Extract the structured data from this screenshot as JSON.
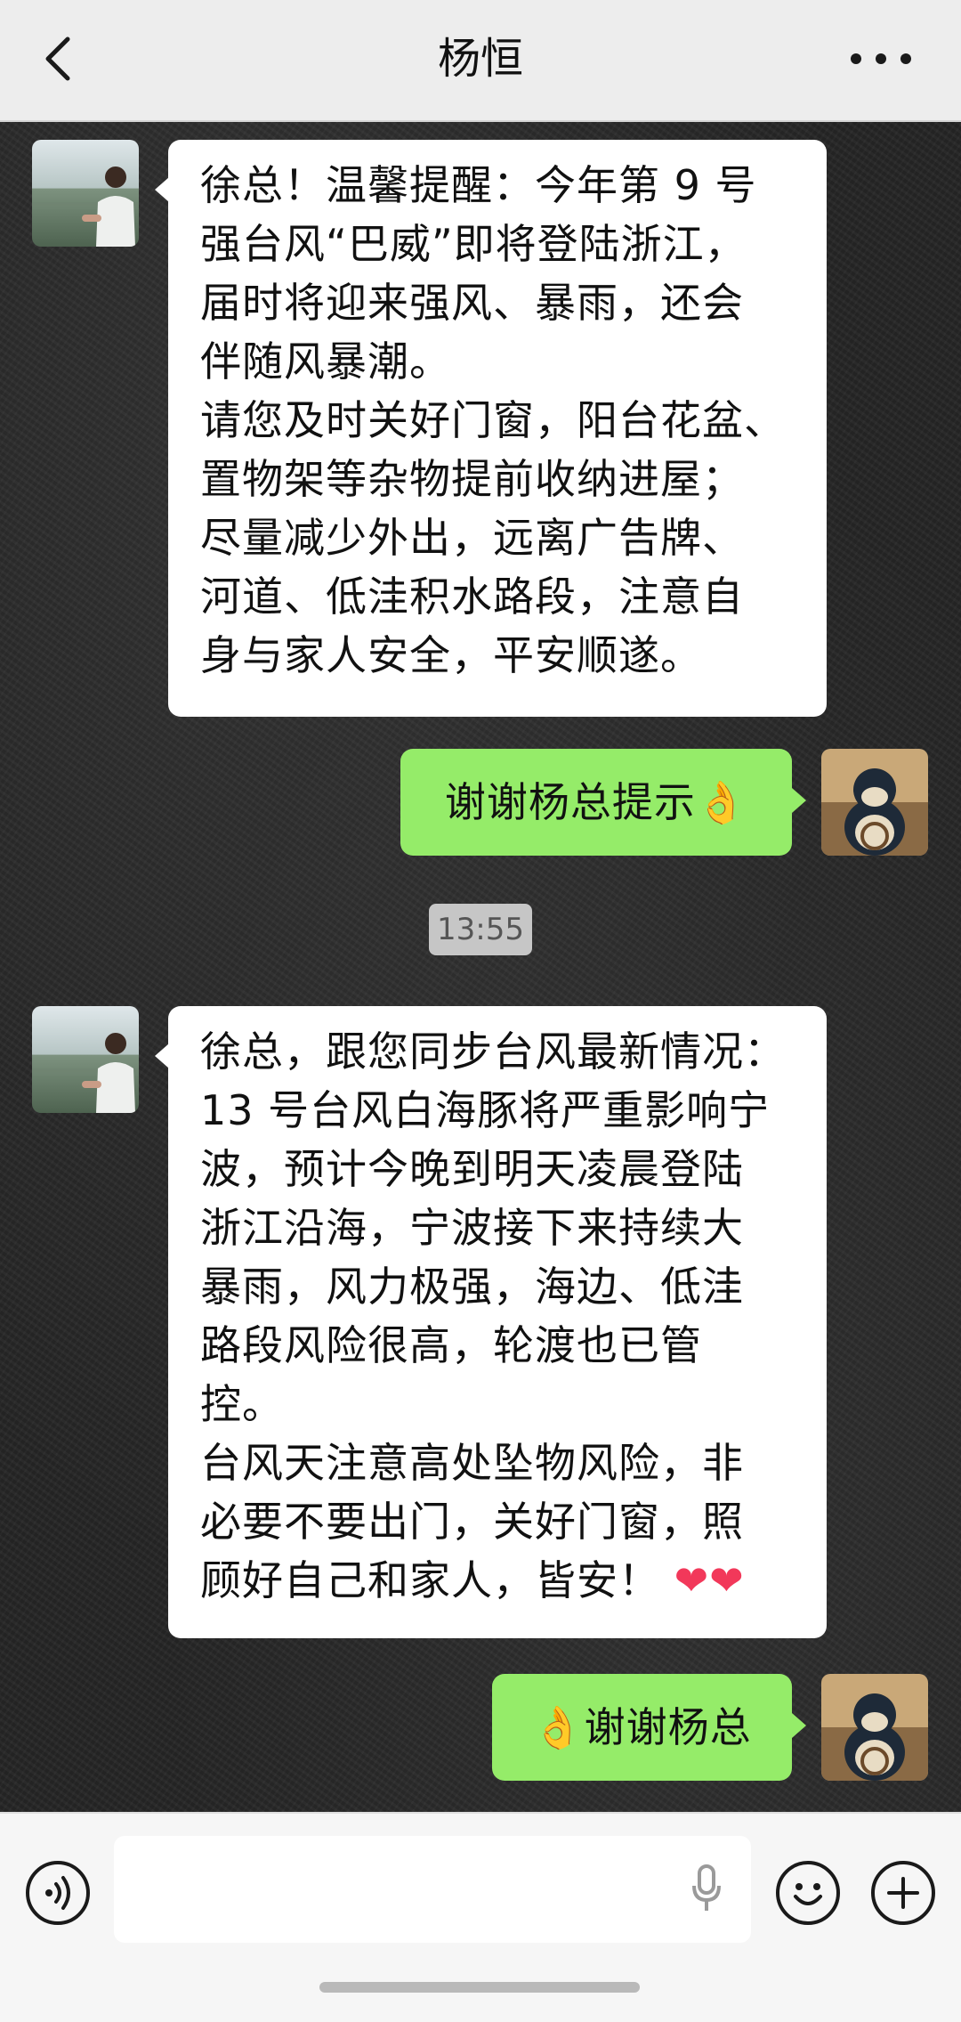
{
  "header": {
    "title": "杨恒"
  },
  "icons": {
    "back": "chevron-left-icon",
    "more": "more-dots-icon",
    "voice": "voice-icon",
    "mic": "microphone-icon",
    "emoji": "emoji-icon",
    "add": "plus-icon"
  },
  "messages": [
    {
      "side": "left",
      "text": "徐总！温馨提醒：今年第 9 号\n强台风“巴威”即将登陆浙江，\n届时将迎来强风、暴雨，还会\n伴随风暴潮。\n请您及时关好门窗，阳台花盆、\n置物架等杂物提前收纳进屋；\n尽量减少外出，远离广告牌、\n河道、低洼积水路段，注意自\n身与家人安全，平安顺遂。"
    },
    {
      "side": "right",
      "text": "谢谢杨总提示👌"
    },
    {
      "side": "left",
      "text": "徐总，跟您同步台风最新情况：\n13 号台风白海豚将严重影响宁\n波，预计今晚到明天凌晨登陆\n浙江沿海，宁波接下来持续大\n暴雨，风力极强，海边、低洼\n路段风险很高，轮渡也已管\n控。\n台风天注意高处坠物风险，非\n必要不要出门，关好门窗，照\n顾好自己和家人，皆安！",
      "suffix": "❤❤"
    },
    {
      "side": "right",
      "text": "👌谢谢杨总"
    }
  ],
  "timestamp": "13:55",
  "colors": {
    "header_bg": "#ededed",
    "sent_bubble": "#95ec69",
    "received_bubble": "#ffffff",
    "chat_bg": "#262626"
  }
}
